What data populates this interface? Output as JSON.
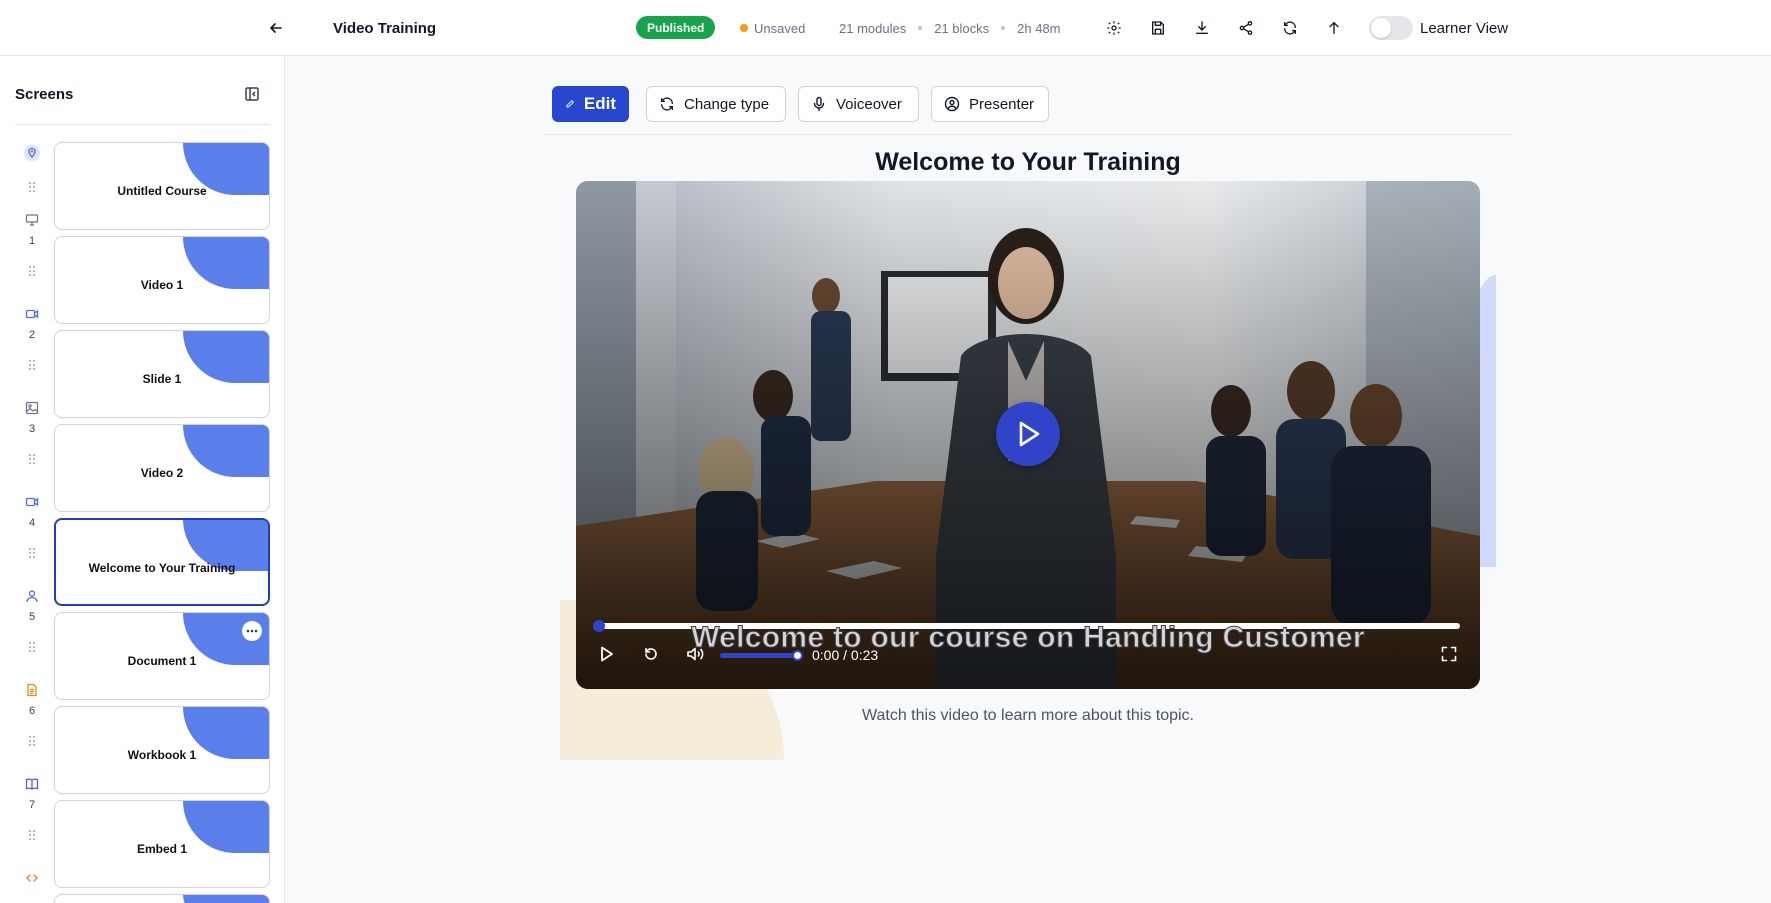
{
  "header": {
    "title": "Video Training",
    "status_badge": "Published",
    "save_state": "Unsaved",
    "stats": [
      "21 modules",
      "21 blocks",
      "2h 48m"
    ],
    "learner_view_label": "Learner View",
    "learner_view_on": false
  },
  "sidebar": {
    "title": "Screens",
    "screens": [
      {
        "num": "",
        "icon": "location-pin-icon",
        "label": "Untitled Course"
      },
      {
        "num": "1",
        "icon": "presentation-icon",
        "label": "Video 1"
      },
      {
        "num": "2",
        "icon": "video-camera-icon",
        "label": "Slide 1"
      },
      {
        "num": "3",
        "icon": "image-icon",
        "label": "Video 2"
      },
      {
        "num": "4",
        "icon": "video-camera-icon",
        "label": "Welcome to Your Training"
      },
      {
        "num": "5",
        "icon": "person-icon",
        "label": "Document 1"
      },
      {
        "num": "6",
        "icon": "document-icon",
        "label": "Workbook 1"
      },
      {
        "num": "7",
        "icon": "book-icon",
        "label": "Embed 1"
      }
    ],
    "trailing_icon": "code-icon"
  },
  "toolbar": {
    "edit": "Edit",
    "change_type": "Change type",
    "voiceover": "Voiceover",
    "presenter": "Presenter"
  },
  "content": {
    "heading": "Welcome to Your Training",
    "caption": "Welcome to our course on Handling Customer",
    "time": "0:00 / 0:23",
    "subtitle": "Watch this video to learn more about this topic."
  },
  "colors": {
    "accent": "#2747cf",
    "published": "#16a34a",
    "unsaved_dot": "#f59e0b",
    "card_blob": "#5b7fea"
  }
}
